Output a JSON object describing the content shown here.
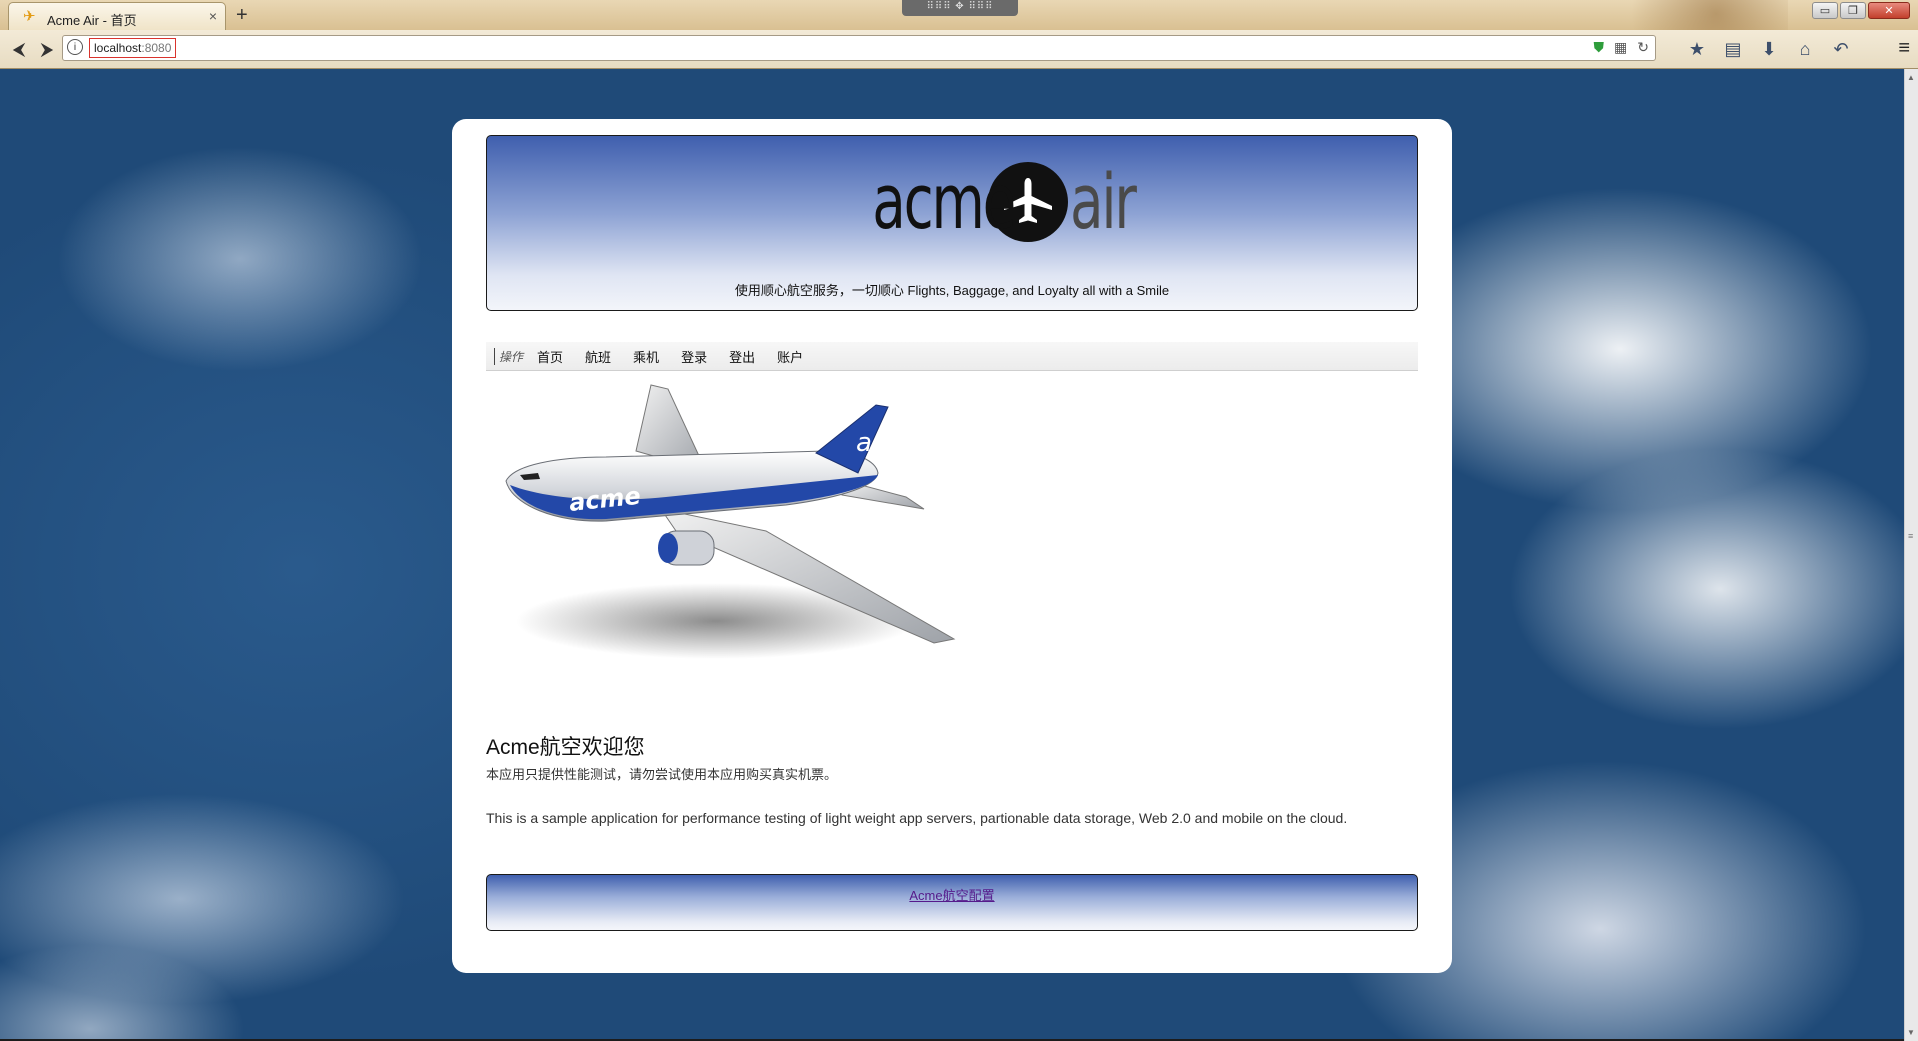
{
  "browser": {
    "tab_title": "Acme Air - 首页",
    "tab_icon": "airplane-icon",
    "close_glyph": "×",
    "new_tab_glyph": "+",
    "url_host": "localhost",
    "url_port": ":8080",
    "window_controls": {
      "minimize": "▭",
      "restore": "❐",
      "close": "✕"
    }
  },
  "header": {
    "logo_left": "acme",
    "logo_right": "air",
    "tagline": "使用顺心航空服务，一切顺心 Flights, Baggage, and Loyalty all with a Smile"
  },
  "menu": {
    "label": "操作",
    "items": [
      "首页",
      "航班",
      "乘机",
      "登录",
      "登出",
      "账户"
    ]
  },
  "welcome": {
    "title": "Acme航空欢迎您",
    "notice_cn": "本应用只提供性能测试，请勿尝试使用本应用购买真实机票。",
    "description": "This is a sample application for performance testing of light weight app servers, partionable data storage, Web 2.0 and mobile on the cloud."
  },
  "footer": {
    "config_link": "Acme航空配置"
  },
  "colors": {
    "header_gradient_top": "#3f5fae",
    "link_visited": "#551a8b",
    "plane_livery_blue": "#2348a8"
  }
}
